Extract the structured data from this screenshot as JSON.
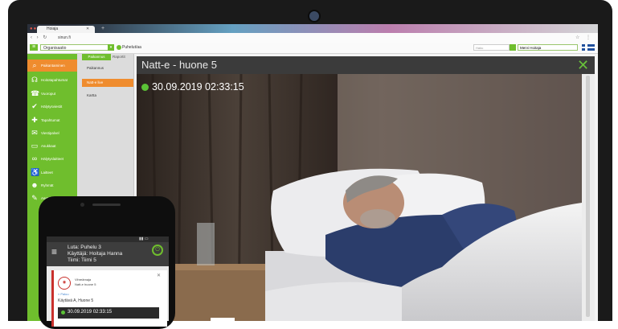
{
  "browser": {
    "tab_title": "Hoiaja",
    "url": "sinun.fi"
  },
  "app": {
    "organization": "Organisaatio",
    "calls_label": "Puhelut/aa",
    "search_placeholder": "Haku",
    "user_select": "Mervi Hoitaja"
  },
  "sidebar": {
    "items": [
      {
        "label": "Paikantaminen",
        "icon": "search-icon",
        "active": true
      },
      {
        "label": "Hoitotapahtumat",
        "icon": "headset-icon",
        "active": false
      },
      {
        "label": "Vuoroput",
        "icon": "phone-icon",
        "active": false
      },
      {
        "label": "Hälytysviestit",
        "icon": "check-icon",
        "active": false
      },
      {
        "label": "Tapahtumat",
        "icon": "plus-icon",
        "active": false
      },
      {
        "label": "Viestipalvel",
        "icon": "mail-icon",
        "active": false
      },
      {
        "label": "Asukkaat",
        "icon": "bed-icon",
        "active": false
      },
      {
        "label": "Hälytyslaitteet",
        "icon": "link-icon",
        "active": false
      },
      {
        "label": "Laitteet",
        "icon": "wheelchair-icon",
        "active": false
      },
      {
        "label": "Ryhmät",
        "icon": "person-icon",
        "active": false
      },
      {
        "label": "Asetukset",
        "icon": "wrench-icon",
        "active": false
      }
    ]
  },
  "subnav": {
    "tabs": [
      "Paikannus",
      "Raportit"
    ],
    "items": [
      {
        "label": "Paikannus",
        "active": false
      },
      {
        "label": "Natt-e live",
        "active": true
      },
      {
        "label": "Kartta",
        "active": false
      }
    ]
  },
  "modal": {
    "title": "Natt-e - huone 5",
    "timestamp": "30.09.2019 02:33:15"
  },
  "phone": {
    "header_line1": "Luta: Puhelu 3",
    "header_line2": "Käyttäjä: Hoitaja Hanna",
    "header_line3": "Tiimi: Tiimi 5",
    "card_line1": "Vihreämaja",
    "card_line2": "Natt-e huone 5",
    "back_label": "« Paluu",
    "room": "Käytävä A, Huone 5",
    "timestamp": "30.09.2019 02:33:15"
  },
  "colors": {
    "accent_green": "#6fbe2d",
    "active_orange": "#ef8c2e",
    "live_dot": "#5bc236"
  }
}
